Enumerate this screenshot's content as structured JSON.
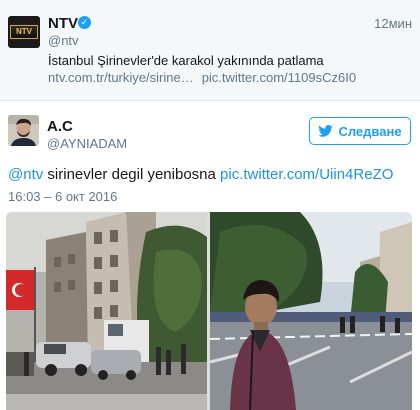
{
  "tweet1": {
    "name": "NTV",
    "handle": "@ntv",
    "time": "12мин",
    "text": "İstanbul Şirinevler'de karakol yakınında patlama",
    "link1": "ntv.com.tr/turkiye/sirine…",
    "link2": "pic.twitter.com/1109sCz6I0",
    "avatar_logo": "NTV"
  },
  "tweet2": {
    "name": "A.C",
    "handle": "@AYNIADAM",
    "follow_label": "Следване",
    "mention": "@ntv",
    "text": " sirinevler degil yenibosna ",
    "pic_link": "pic.twitter.com/Uiin4ReZO",
    "date": "16:03 – 6 окт 2016"
  },
  "colors": {
    "accent": "#1da1f2",
    "link": "#1b95e0",
    "muted": "#657786"
  },
  "icons": {
    "verified": "verified-badge-icon",
    "follow": "twitter-bird-icon"
  }
}
